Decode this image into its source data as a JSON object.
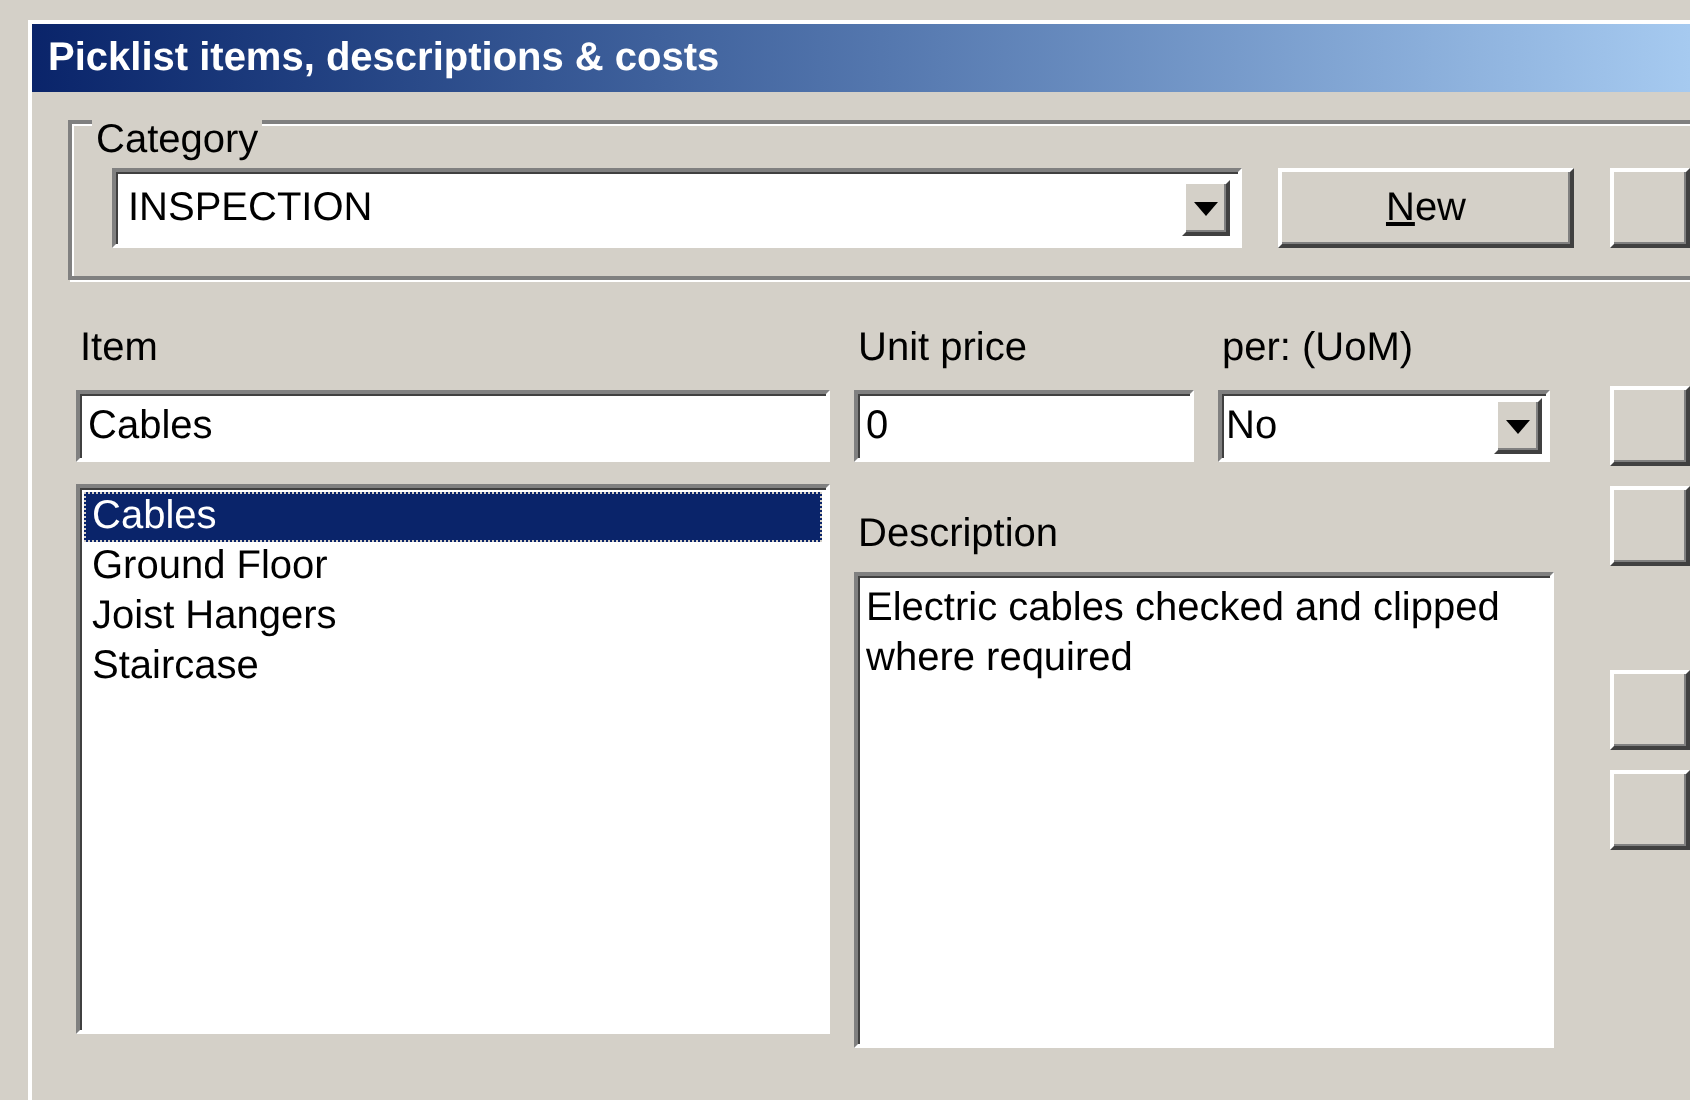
{
  "window": {
    "title": "Picklist items, descriptions & costs"
  },
  "category": {
    "legend": "Category",
    "value": "INSPECTION",
    "buttons": [
      {
        "kind": "text",
        "label": "New",
        "underline_first": true
      },
      {
        "kind": "cut"
      }
    ]
  },
  "item": {
    "label": "Item",
    "value": "Cables"
  },
  "unit_price": {
    "label": "Unit price",
    "value": "0"
  },
  "uom": {
    "label": "per: (UoM)",
    "value": "No"
  },
  "items_list": [
    {
      "text": "Cables",
      "selected": true
    },
    {
      "text": "Ground Floor",
      "selected": false
    },
    {
      "text": "Joist Hangers",
      "selected": false
    },
    {
      "text": "Staircase",
      "selected": false
    }
  ],
  "description": {
    "label": "Description",
    "value": "Electric cables checked and clipped where required"
  }
}
